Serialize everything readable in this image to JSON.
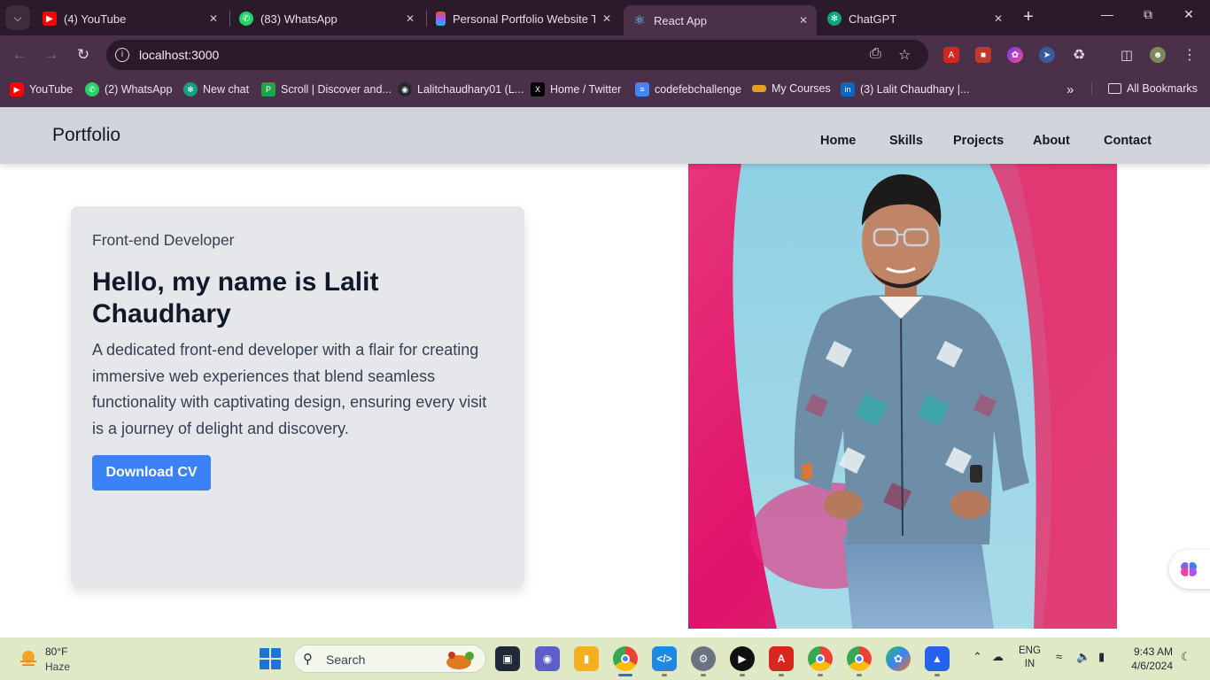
{
  "browser": {
    "tabs": [
      {
        "title": "(4) YouTube",
        "favicon": "youtube-icon",
        "color": "#ff0000"
      },
      {
        "title": "(83) WhatsApp",
        "favicon": "whatsapp-icon",
        "color": "#25d366"
      },
      {
        "title": "Personal Portfolio Website Te",
        "favicon": "figma-icon",
        "color": "#a259ff"
      },
      {
        "title": "React App",
        "favicon": "react-icon",
        "color": "#61dafb"
      },
      {
        "title": "ChatGPT",
        "favicon": "chatgpt-icon",
        "color": "#10a37f"
      }
    ],
    "active_tab": 3,
    "address": "localhost:3000",
    "bookmarks": [
      {
        "label": "YouTube",
        "icon": "youtube-icon",
        "color": "#ff0000"
      },
      {
        "label": "(2) WhatsApp",
        "icon": "whatsapp-icon",
        "color": "#25d366"
      },
      {
        "label": "New chat",
        "icon": "chatgpt-icon",
        "color": "#10a37f"
      },
      {
        "label": "Scroll | Discover and...",
        "icon": "scroll-icon",
        "color": "#22a34a"
      },
      {
        "label": "Lalitchaudhary01 (L...",
        "icon": "github-icon",
        "color": "#24292f"
      },
      {
        "label": "Home / Twitter",
        "icon": "x-icon",
        "color": "#000000"
      },
      {
        "label": "codefebchallenge",
        "icon": "docs-icon",
        "color": "#4285f4"
      },
      {
        "label": "My Courses",
        "icon": "courses-icon",
        "color": "#e0a020"
      },
      {
        "label": "(3) Lalit Chaudhary |...",
        "icon": "linkedin-icon",
        "color": "#0a66c2"
      }
    ],
    "all_bookmarks": "All Bookmarks"
  },
  "site": {
    "brand": "Portfolio",
    "nav": [
      "Home",
      "Skills",
      "Projects",
      "About",
      "Contact"
    ],
    "hero": {
      "role": "Front-end Developer",
      "headline": "Hello, my name is Lalit Chaudhary",
      "description": "A dedicated front-end developer with a flair for creating immersive web experiences that blend seamless functionality with captivating design, ensuring every visit is a journey of delight and discovery.",
      "cta": "Download CV"
    }
  },
  "taskbar": {
    "weather_temp": "80°F",
    "weather_cond": "Haze",
    "search": "Search",
    "lang_top": "ENG",
    "lang_bottom": "IN",
    "time": "9:43 AM",
    "date": "4/6/2024"
  }
}
